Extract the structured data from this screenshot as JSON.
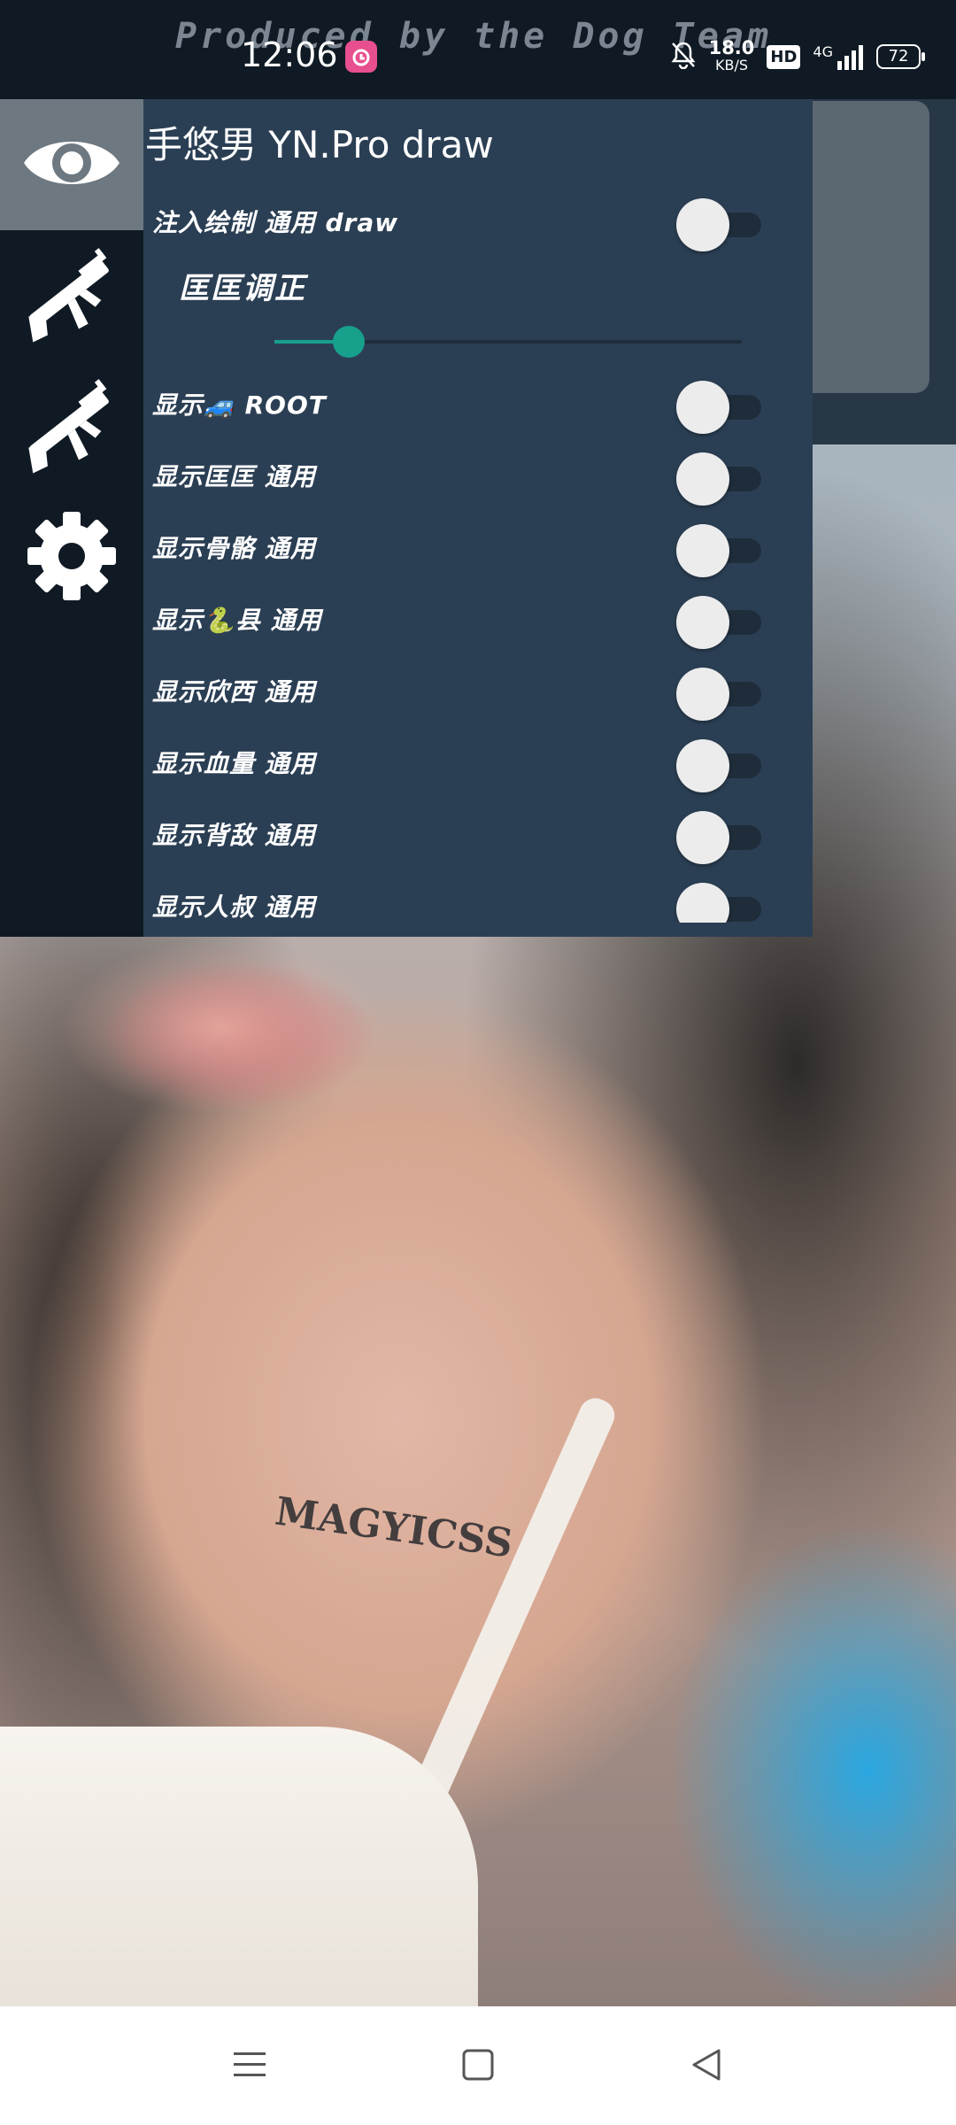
{
  "status_bar": {
    "watermark": "Produced by the Dog Team",
    "time": "12:06",
    "net_speed_value": "18.0",
    "net_speed_unit": "KB/S",
    "hd_badge": "HD",
    "network": "4G",
    "battery": "72"
  },
  "sidebar": {
    "tabs": [
      {
        "icon": "eye-icon",
        "active": true
      },
      {
        "icon": "rifle-icon",
        "active": false
      },
      {
        "icon": "rifle-icon",
        "active": false
      },
      {
        "icon": "gear-icon",
        "active": false
      }
    ]
  },
  "menu": {
    "title": "手悠男 YN.Pro  draw",
    "inject_label": "注入绘制  通用  draw",
    "slider_label": "匡匡调正",
    "slider_value": 0.16,
    "items": [
      {
        "label": "显示🚙  ROOT",
        "on": false
      },
      {
        "label": "显示匡匡  通用",
        "on": false
      },
      {
        "label": "显示骨骼  通用",
        "on": false
      },
      {
        "label": "显示🐍县  通用",
        "on": false
      },
      {
        "label": "显示欣西  通用",
        "on": false
      },
      {
        "label": "显示血量  通用",
        "on": false
      },
      {
        "label": "显示背敌  通用",
        "on": false
      },
      {
        "label": "显示人叔  通用",
        "on": false
      }
    ]
  },
  "background": {
    "tattoo_text": "MAGYICSS"
  },
  "colors": {
    "panel": "#2b3f54",
    "rail": "#0f1a24",
    "accent": "#17a08c",
    "knob": "#ececec"
  }
}
